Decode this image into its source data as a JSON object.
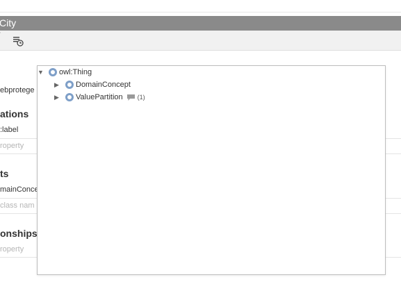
{
  "window": {
    "title": "City"
  },
  "side_panel": {
    "iri_fragment": "ebprotege",
    "annotations_heading": "ations",
    "annotation_label": ":label",
    "annotation_placeholder": "roperty",
    "parents_heading": "ts",
    "parent_value": "mainConce",
    "parent_placeholder": "class nam",
    "relationships_heading": "onships",
    "relationships_placeholder": "roperty"
  },
  "class_tree": {
    "root": {
      "label": "owl:Thing",
      "expanded": true
    },
    "children": [
      {
        "label": "DomainConcept",
        "expanded": false,
        "comment_count": ""
      },
      {
        "label": "ValuePartition",
        "expanded": false,
        "comment_count": "(1)"
      }
    ]
  },
  "colors": {
    "title_bar": "#8a8a8a",
    "class_icon": "#7e9fc8",
    "placeholder_text": "#b5b5b5"
  },
  "icons": {
    "toolbar_history": "history-list-icon",
    "tree_collapse": "triangle-down-icon",
    "tree_expand": "triangle-right-icon",
    "class": "owl-class-icon",
    "comment": "comment-icon"
  }
}
